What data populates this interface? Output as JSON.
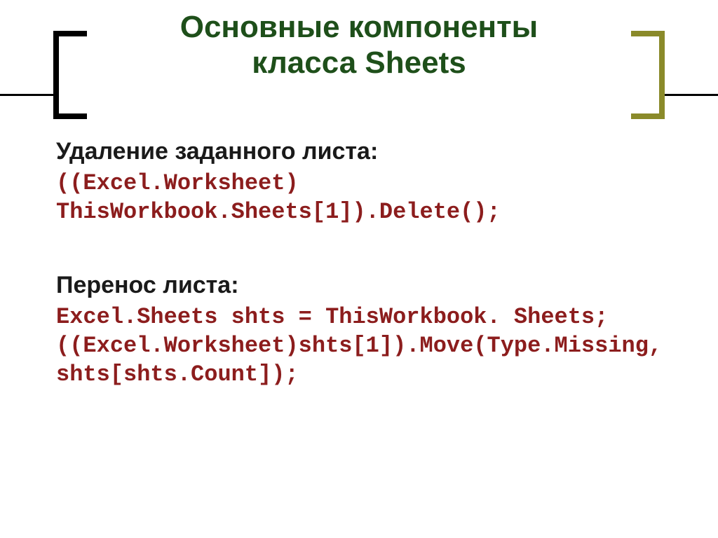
{
  "title_line1": "Основные компоненты",
  "title_line2": "класса Sheets",
  "section1": {
    "heading": "Удаление заданного листа:",
    "code": "((Excel.Worksheet) ThisWorkbook.Sheets[1]).Delete();"
  },
  "section2": {
    "heading": "Перенос листа:",
    "code": "Excel.Sheets shts = ThisWorkbook. Sheets;\n((Excel.Worksheet)shts[1]).Move(Type.Missing, shts[shts.Count]);"
  }
}
